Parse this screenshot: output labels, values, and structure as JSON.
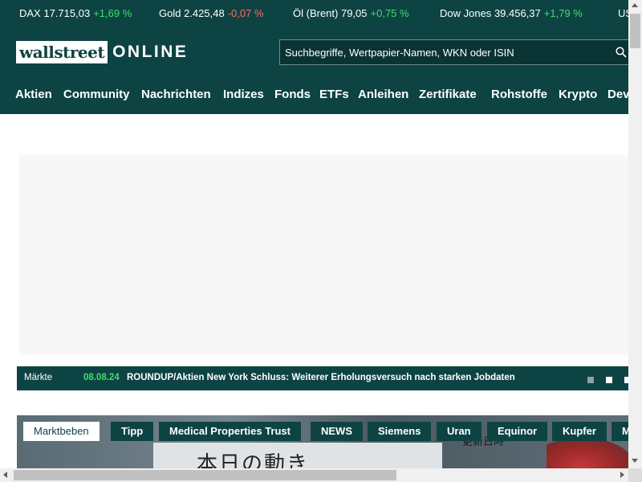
{
  "ticker": [
    {
      "name": "DAX",
      "value": "17.715,03",
      "change": "+1,69 %",
      "dir": "pos"
    },
    {
      "name": "Gold",
      "value": "2.425,48",
      "change": "-0,07 %",
      "dir": "neg"
    },
    {
      "name": "Öl (Brent)",
      "value": "79,05",
      "change": "+0,75 %",
      "dir": "pos"
    },
    {
      "name": "Dow Jones",
      "value": "39.456,37",
      "change": "+1,79 %",
      "dir": "pos"
    },
    {
      "name": "US",
      "value": "",
      "change": "",
      "dir": "pos"
    }
  ],
  "logo": {
    "box": "wallstreet",
    "online": "ONLINE"
  },
  "search": {
    "placeholder": "Suchbegriffe, Wertpapier-Namen, WKN oder ISIN",
    "icon": "search-icon"
  },
  "nav": [
    "Aktien",
    "Community",
    "Nachrichten",
    "Indizes",
    "Fonds",
    "ETFs",
    "Anleihen",
    "Zertifikate",
    "Rohstoffe",
    "Krypto",
    "Dev"
  ],
  "news": {
    "category": "Märkte",
    "date": "08.08.24",
    "title": "ROUNDUP/Aktien New York Schluss: Weiterer Erholungsversuch nach starken Jobdaten"
  },
  "tags": [
    "Marktbeben",
    "Tipp",
    "Medical Properties Trust",
    "NEWS",
    "Siemens",
    "Uran",
    "Equinor",
    "Kupfer",
    "M"
  ],
  "hero": {
    "sign_text": "本日の動き",
    "small_text": "更新日時"
  },
  "colors": {
    "brand": "#0e4343",
    "positive": "#3ee06a",
    "negative": "#ff6b5e"
  }
}
